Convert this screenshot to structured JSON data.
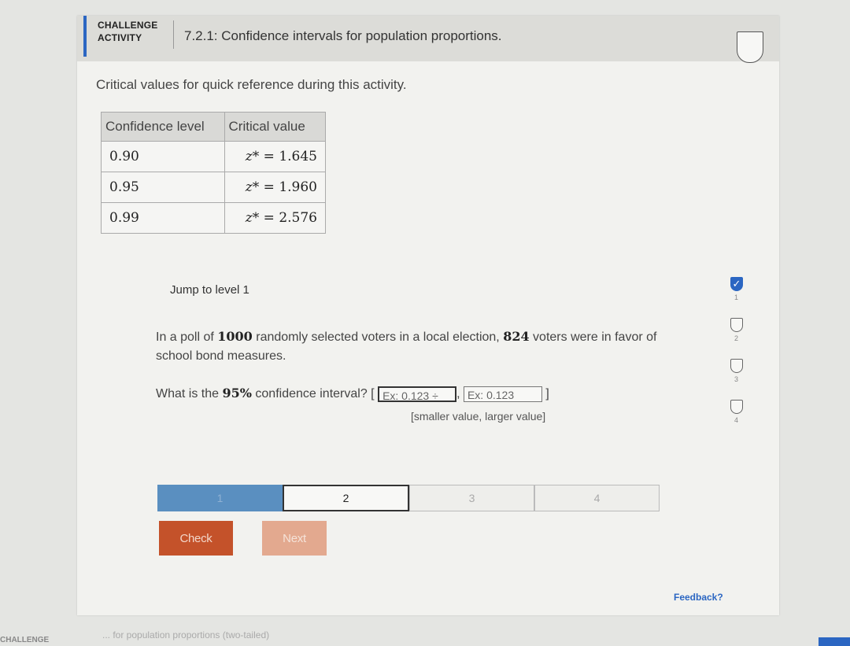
{
  "header": {
    "label_line1": "CHALLENGE",
    "label_line2": "ACTIVITY",
    "title": "7.2.1: Confidence intervals for population proportions."
  },
  "critical_values": {
    "caption": "Critical values for quick reference during this activity.",
    "columns": [
      "Confidence level",
      "Critical value"
    ],
    "rows": [
      {
        "level": "0.90",
        "z_symbol": "z*",
        "value": "= 1.645"
      },
      {
        "level": "0.95",
        "z_symbol": "z*",
        "value": "= 1.960"
      },
      {
        "level": "0.99",
        "z_symbol": "z*",
        "value": "= 2.576"
      }
    ]
  },
  "jump": "Jump to level 1",
  "question": {
    "part1": "In a poll of ",
    "n": "1000",
    "part2": " randomly selected voters in a local election, ",
    "k": "824",
    "part3": " voters were in favor of school bond measures."
  },
  "ci": {
    "prefix": "What is the ",
    "pct": "95%",
    "suffix": " confidence interval? [",
    "input1_placeholder": "Ex: 0.123",
    "spinner": "÷",
    "comma": ",",
    "input2_placeholder": "Ex: 0.123",
    "close": "]",
    "hint": "[smaller value, larger value]"
  },
  "progress": {
    "segments": [
      "1",
      "2",
      "3",
      "4"
    ],
    "current": 2
  },
  "buttons": {
    "check": "Check",
    "next": "Next"
  },
  "levels": [
    {
      "num": "1",
      "checked": true
    },
    {
      "num": "2",
      "checked": false
    },
    {
      "num": "3",
      "checked": false
    },
    {
      "num": "4",
      "checked": false
    }
  ],
  "check_glyph": "✓",
  "feedback": "Feedback?",
  "footer": {
    "left": "CHALLENGE",
    "strip": "... for population proportions (two-tailed)"
  },
  "colors": {
    "accent": "#2b66c2",
    "check_button": "#c4522a",
    "next_button": "#e3a98f",
    "progress_done": "#5a8fc0"
  }
}
